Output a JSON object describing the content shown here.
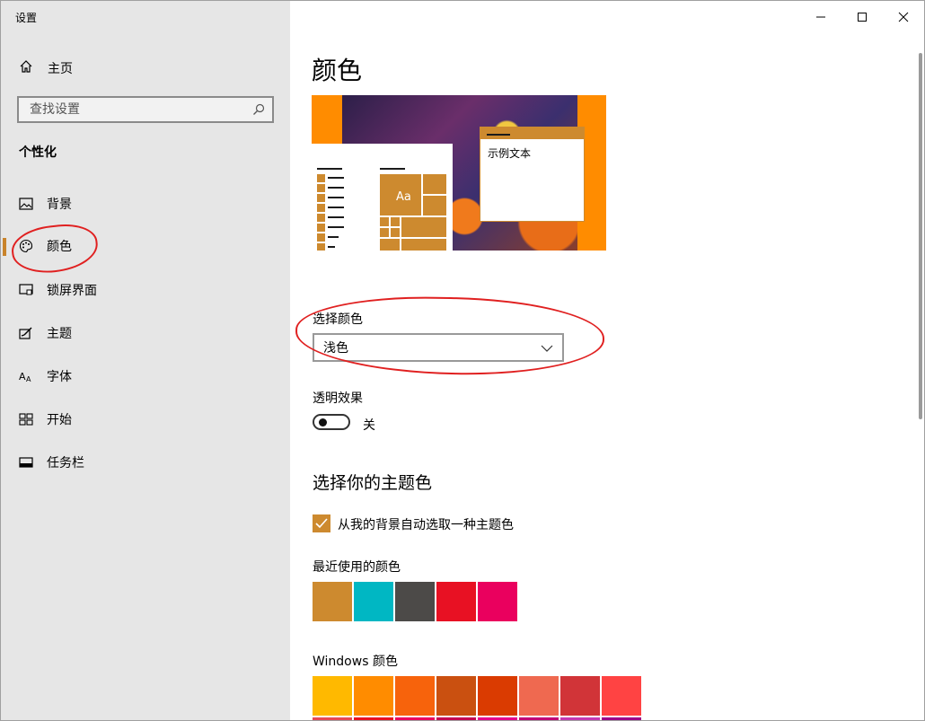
{
  "window": {
    "title": "设置"
  },
  "sidebar": {
    "home_label": "主页",
    "search_placeholder": "查找设置",
    "section_title": "个性化",
    "items": [
      {
        "label": "背景",
        "icon": "image-icon"
      },
      {
        "label": "颜色",
        "icon": "palette-icon",
        "active": true
      },
      {
        "label": "锁屏界面",
        "icon": "lock-screen-icon"
      },
      {
        "label": "主题",
        "icon": "theme-icon"
      },
      {
        "label": "字体",
        "icon": "font-icon"
      },
      {
        "label": "开始",
        "icon": "start-icon"
      },
      {
        "label": "任务栏",
        "icon": "taskbar-icon"
      }
    ]
  },
  "main": {
    "page_title": "颜色",
    "preview": {
      "tile_text": "Aa",
      "sample_text": "示例文本"
    },
    "choose_color_label": "选择颜色",
    "choose_color_value": "浅色",
    "transparency_label": "透明效果",
    "transparency_state": "关",
    "accent_title": "选择你的主题色",
    "auto_accent_label": "从我的背景自动选取一种主题色",
    "recent_colors_label": "最近使用的颜色",
    "recent_colors": [
      "#cd8a2f",
      "#00b7c3",
      "#4c4a48",
      "#e81123",
      "#ea005e"
    ],
    "windows_colors_label": "Windows 颜色",
    "windows_colors": [
      "#ffb900",
      "#ff8c00",
      "#f7630c",
      "#ca5010",
      "#da3b01",
      "#ef6950",
      "#d13438",
      "#ff4343"
    ],
    "windows_colors_row2": [
      "#e74856",
      "#e81123",
      "#ea005e",
      "#c30052",
      "#e3008c",
      "#bf0077",
      "#c239b3",
      "#9a0089"
    ]
  },
  "colors": {
    "accent": "#cd8a2f",
    "annotation": "#e02020"
  }
}
